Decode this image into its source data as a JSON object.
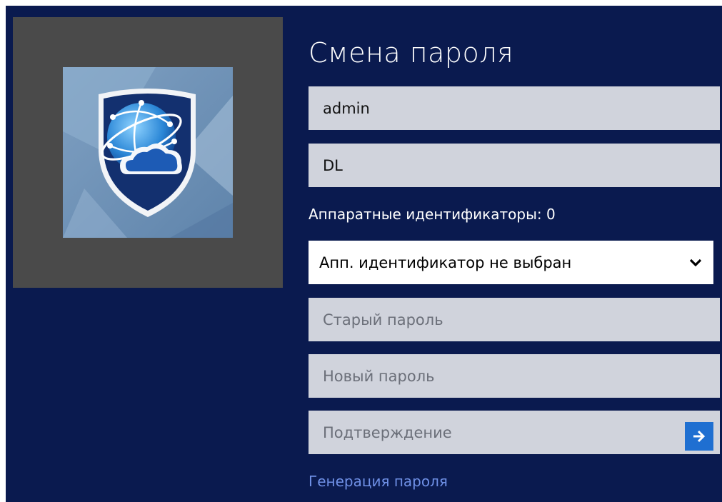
{
  "dialog": {
    "title": "Смена пароля",
    "username": "admin",
    "domain": "DL",
    "hardware_ids_label": "Аппаратные идентификаторы: 0",
    "hardware_id_select": "Апп. идентификатор не выбран",
    "old_password_placeholder": "Старый пароль",
    "new_password_placeholder": "Новый пароль",
    "confirm_placeholder": "Подтверждение",
    "generate_password_link": "Генерация пароля"
  },
  "icons": {
    "user_tile": "shield-globe-cloud-icon",
    "select_chevron": "chevron-down-icon",
    "submit": "arrow-right-icon"
  },
  "colors": {
    "background": "#0a1a4f",
    "field": "#d0d3dc",
    "accent": "#1f6fd1",
    "link": "#6f90e6"
  }
}
